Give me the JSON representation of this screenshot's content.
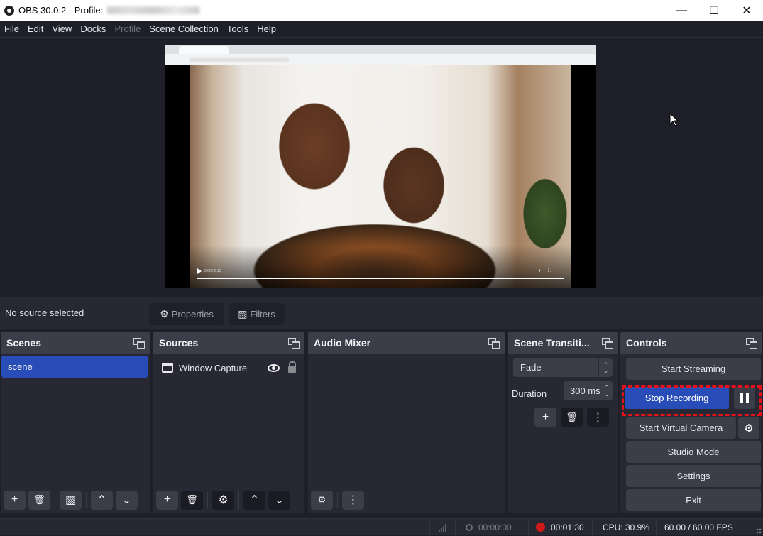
{
  "window": {
    "title": "OBS 30.0.2 - Profile:",
    "controls": {
      "minimize": "—",
      "maximize": "☐",
      "close": "✕"
    }
  },
  "menu": [
    {
      "label": "File",
      "enabled": true
    },
    {
      "label": "Edit",
      "enabled": true
    },
    {
      "label": "View",
      "enabled": true
    },
    {
      "label": "Docks",
      "enabled": true
    },
    {
      "label": "Profile",
      "enabled": false
    },
    {
      "label": "Scene Collection",
      "enabled": true
    },
    {
      "label": "Tools",
      "enabled": true
    },
    {
      "label": "Help",
      "enabled": true
    }
  ],
  "context_bar": {
    "status": "No source selected",
    "properties_label": "Properties",
    "filters_label": "Filters"
  },
  "docks": {
    "scenes": {
      "title": "Scenes",
      "items": [
        "scene"
      ],
      "selected": "scene"
    },
    "sources": {
      "title": "Sources",
      "items": [
        {
          "name": "Window Capture",
          "visible": true,
          "locked": false
        }
      ]
    },
    "audio_mixer": {
      "title": "Audio Mixer"
    },
    "transitions": {
      "title": "Scene Transiti...",
      "transition": "Fade",
      "duration_label": "Duration",
      "duration_value": "300 ms"
    },
    "controls": {
      "title": "Controls",
      "start_streaming": "Start Streaming",
      "stop_recording": "Stop Recording",
      "start_virtual_camera": "Start Virtual Camera",
      "studio_mode": "Studio Mode",
      "settings": "Settings",
      "exit": "Exit"
    }
  },
  "icons": {
    "add": "+",
    "remove": "🗑",
    "more": "⋮",
    "up": "⌃",
    "down": "⌄",
    "gear": "⚙",
    "gears": "⚙",
    "filter": "▧",
    "updown": "⌃⌄"
  },
  "statusbar": {
    "stream_time": "00:00:00",
    "record_time": "00:01:30",
    "cpu": "CPU: 30.9%",
    "fps": "60.00 / 60.00 FPS"
  },
  "colors": {
    "accent": "#284cb8",
    "record": "#d01a1a",
    "highlight": "#e8101a"
  }
}
